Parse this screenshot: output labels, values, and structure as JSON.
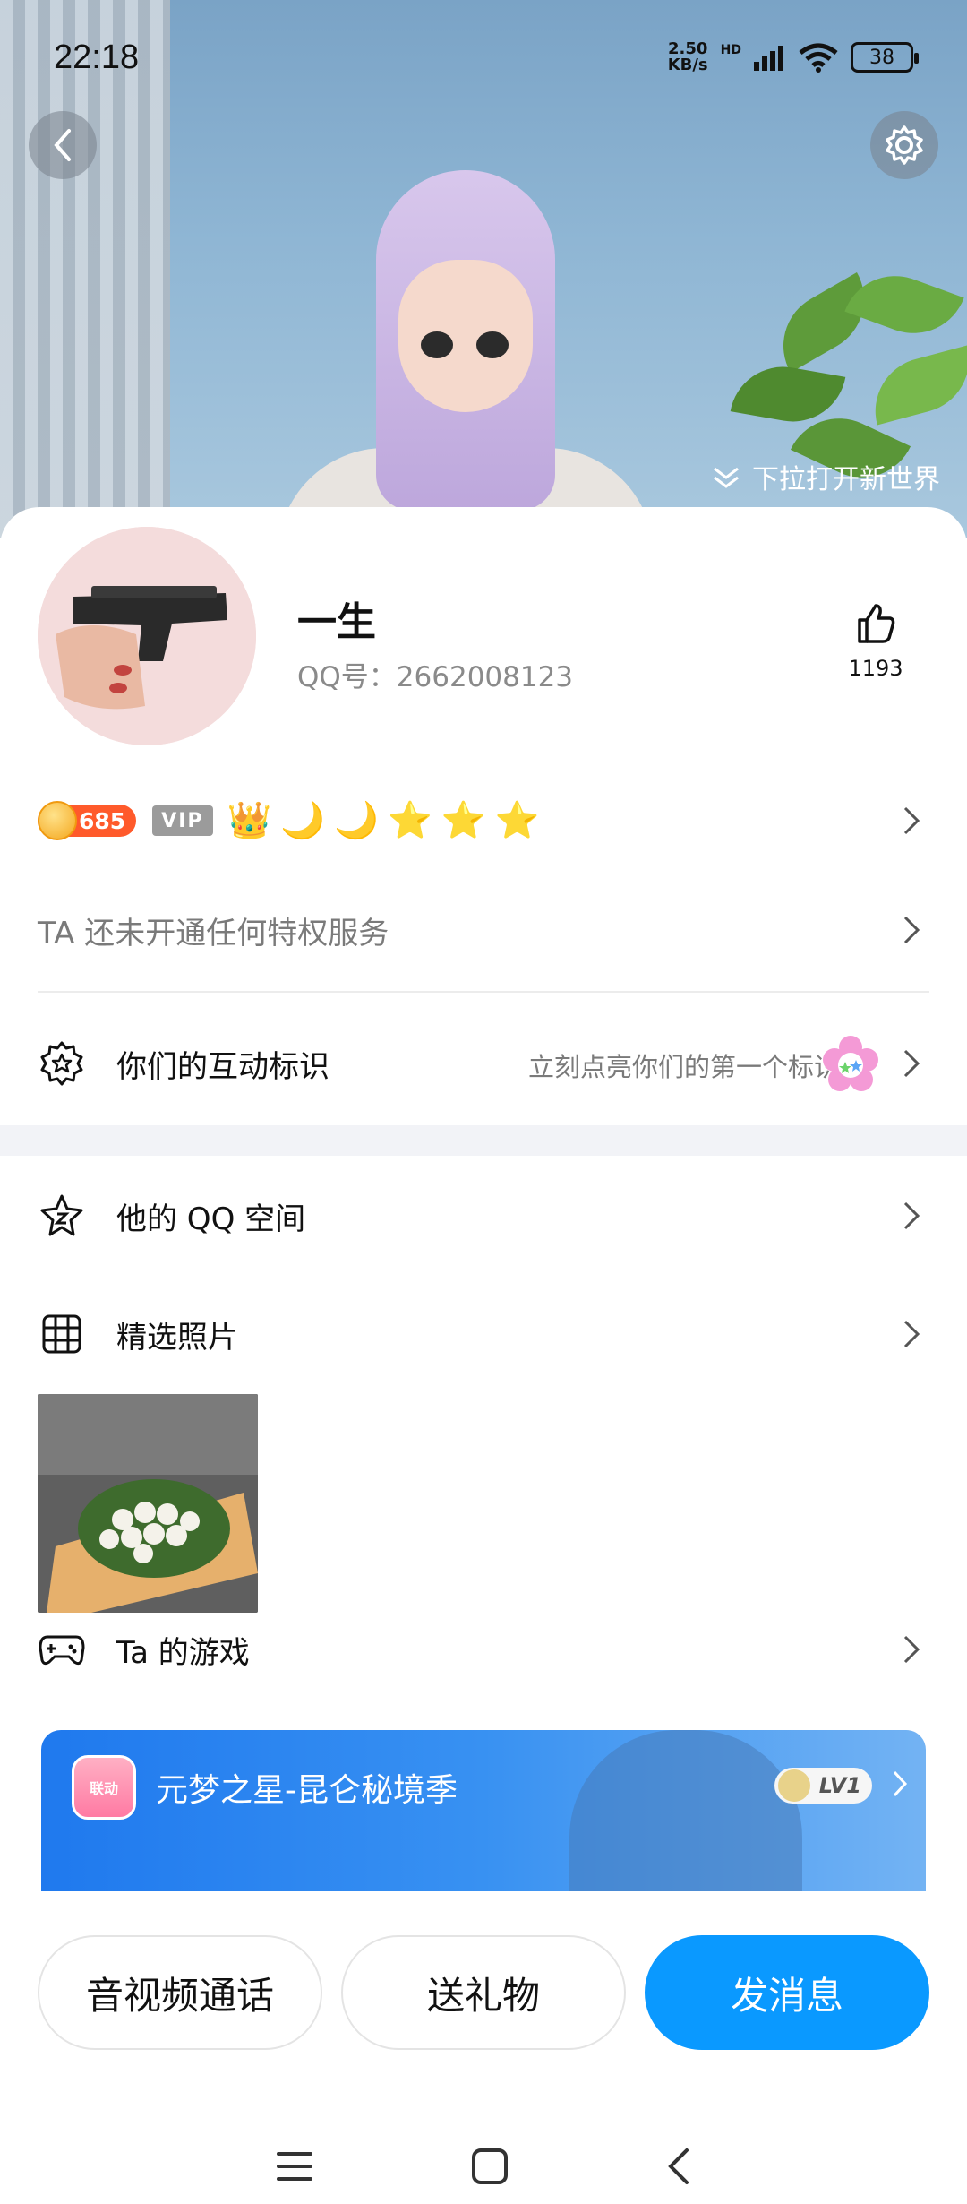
{
  "status_bar": {
    "time": "22:18",
    "net_speed_top": "2.50",
    "net_speed_bottom": "KB/s",
    "hd": "HD",
    "battery": "38"
  },
  "hero": {
    "pull_hint": "下拉打开新世界"
  },
  "profile": {
    "name": "一生",
    "qq_label": "QQ号：2662008123",
    "likes": "1193"
  },
  "badges": {
    "coin_value": "685",
    "vip_label": "VIP",
    "level_icons": [
      "👑",
      "🌙",
      "🌙",
      "⭐",
      "⭐",
      "⭐"
    ]
  },
  "privilege": {
    "text": "TA 还未开通任何特权服务"
  },
  "interaction": {
    "label": "你们的互动标识",
    "hint": "立刻点亮你们的第一个标识"
  },
  "sections": {
    "qzone": "他的 QQ 空间",
    "photos": "精选照片",
    "games": "Ta 的游戏"
  },
  "game": {
    "badge_text": "联动",
    "title": "元梦之星-昆仑秘境季",
    "level": "LV1"
  },
  "actions": {
    "call": "音视频通话",
    "gift": "送礼物",
    "message": "发消息"
  },
  "colors": {
    "primary": "#0a99ff",
    "coin": "#ff5a2b",
    "vip": "#9b9b9b"
  }
}
